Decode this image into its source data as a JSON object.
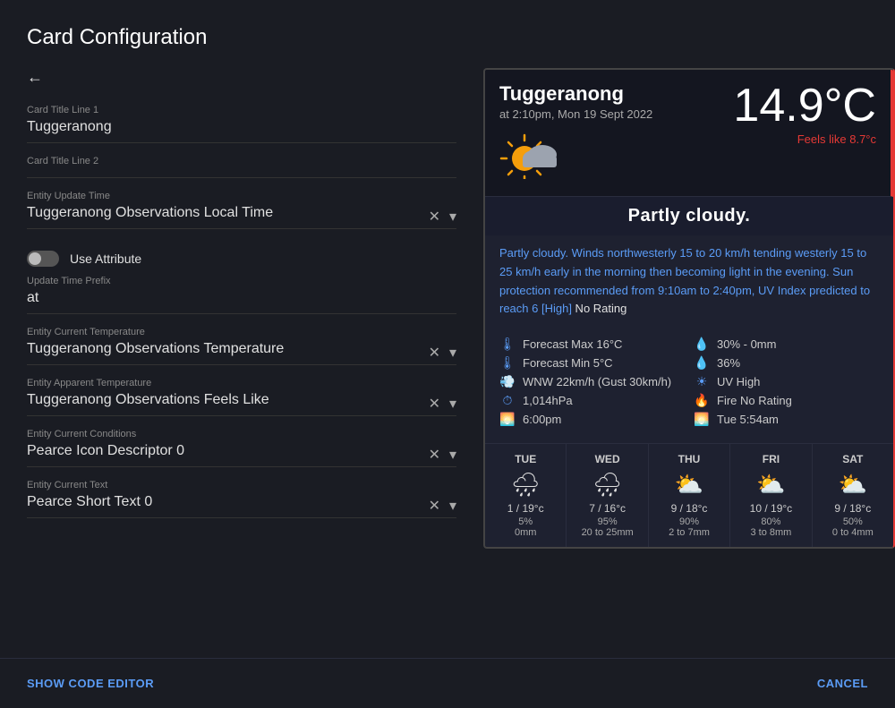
{
  "page": {
    "title": "Card Configuration"
  },
  "left": {
    "back_arrow": "←",
    "fields": [
      {
        "label": "Card Title Line 1",
        "value": "Tuggeranong",
        "has_actions": false
      },
      {
        "label": "Card Title Line 2",
        "value": "",
        "has_actions": false
      },
      {
        "label": "Entity Update Time",
        "value": "Tuggeranong Observations Local Time",
        "has_actions": true
      },
      {
        "label": "Update Time Prefix",
        "value": "at",
        "has_actions": false
      },
      {
        "label": "Entity Current Temperature",
        "value": "Tuggeranong Observations Temperature",
        "has_actions": true
      },
      {
        "label": "Entity Apparent Temperature",
        "value": "Tuggeranong Observations Feels Like",
        "has_actions": true
      },
      {
        "label": "Entity Current Conditions",
        "value": "Pearce Icon Descriptor 0",
        "has_actions": true
      },
      {
        "label": "Entity Current Text",
        "value": "Pearce Short Text 0",
        "has_actions": true
      }
    ],
    "toggle": {
      "label": "Use Attribute",
      "checked": false
    }
  },
  "weather": {
    "city": "Tuggeranong",
    "date": "at 2:10pm, Mon 19 Sept 2022",
    "temperature": "14.9",
    "temp_unit": "°C",
    "feels_like": "Feels like 8.7°c",
    "condition": "Partly cloudy.",
    "description": "Partly cloudy. Winds northwesterly 15 to 20 km/h tending westerly 15 to 25 km/h early in the morning then becoming light in the evening. Sun protection recommended from 9:10am to 2:40pm, UV Index predicted to reach 6 [High]",
    "description_suffix": " No Rating",
    "details": [
      {
        "icon": "🌡",
        "text": "Forecast Max 16°C"
      },
      {
        "icon": "💧",
        "text": "30% - 0mm"
      },
      {
        "icon": "🌡",
        "text": "Forecast Min 5°C"
      },
      {
        "icon": "💧",
        "text": "36%"
      },
      {
        "icon": "💨",
        "text": "WNW 22km/h (Gust 30km/h)"
      },
      {
        "icon": "☀",
        "text": "UV High"
      },
      {
        "icon": "🕐",
        "text": "1,014hPa"
      },
      {
        "icon": "🔥",
        "text": "Fire No Rating"
      },
      {
        "icon": "🌅",
        "text": "6:00pm"
      },
      {
        "icon": "🌅",
        "text": "Tue 5:54am"
      }
    ],
    "forecast": [
      {
        "day": "TUE",
        "icon": "🌧",
        "temp": "1 / 19°c",
        "rain": "5%",
        "mm": "0mm"
      },
      {
        "day": "WED",
        "icon": "🌧",
        "temp": "7 / 16°c",
        "rain": "95%",
        "mm": "20 to 25mm"
      },
      {
        "day": "THU",
        "icon": "⛅",
        "temp": "9 / 18°c",
        "rain": "90%",
        "mm": "2 to 7mm"
      },
      {
        "day": "FRI",
        "icon": "⛅",
        "temp": "10 / 19°c",
        "rain": "80%",
        "mm": "3 to 8mm"
      },
      {
        "day": "SAT",
        "icon": "⛅",
        "temp": "9 / 18°c",
        "rain": "50%",
        "mm": "0 to 4mm"
      }
    ]
  },
  "bottom": {
    "show_code": "SHOW CODE EDITOR",
    "cancel": "CANCEL"
  }
}
